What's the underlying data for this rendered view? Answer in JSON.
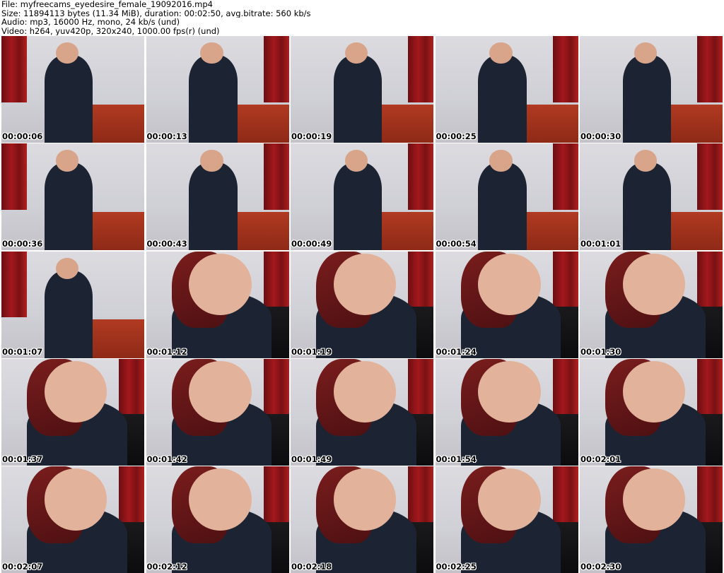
{
  "header": {
    "line1": "File: myfreecams_eyedesire_female_19092016.mp4",
    "line2": "Size: 11894113 bytes (11.34 MiB), duration: 00:02:50, avg.bitrate: 560 kb/s",
    "line3": "Audio: mp3, 16000 Hz, mono, 24 kb/s (und)",
    "line4": "Video: h264, yuv420p, 320x240, 1000.00 fps(r) (und)"
  },
  "thumbnails": [
    {
      "time": "00:00:06"
    },
    {
      "time": "00:00:13"
    },
    {
      "time": "00:00:19"
    },
    {
      "time": "00:00:25"
    },
    {
      "time": "00:00:30"
    },
    {
      "time": "00:00:36"
    },
    {
      "time": "00:00:43"
    },
    {
      "time": "00:00:49"
    },
    {
      "time": "00:00:54"
    },
    {
      "time": "00:01:01"
    },
    {
      "time": "00:01:07"
    },
    {
      "time": "00:01:12"
    },
    {
      "time": "00:01:19"
    },
    {
      "time": "00:01:24"
    },
    {
      "time": "00:01:30"
    },
    {
      "time": "00:01:37"
    },
    {
      "time": "00:01:42"
    },
    {
      "time": "00:01:49"
    },
    {
      "time": "00:01:54"
    },
    {
      "time": "00:02:01"
    },
    {
      "time": "00:02:07"
    },
    {
      "time": "00:02:12"
    },
    {
      "time": "00:02:18"
    },
    {
      "time": "00:02:25"
    },
    {
      "time": "00:02:30"
    }
  ]
}
